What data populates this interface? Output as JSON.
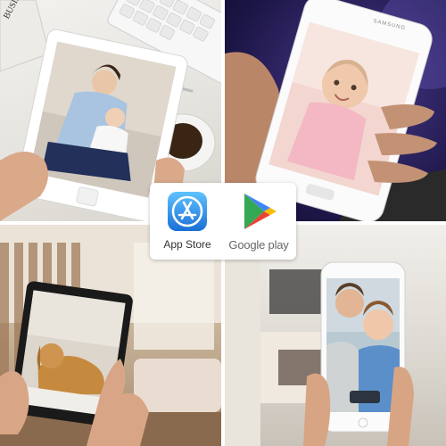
{
  "scenes": {
    "tablet_mother_baby": "tablet-mother-baby",
    "phone_baby": "phone-baby",
    "tablet_dog": "tablet-dog",
    "phone_father_son": "phone-father-son"
  },
  "printed_text": {
    "newspaper": "BUSINESS",
    "phone_brand": "SAMSUNG"
  },
  "stores": [
    {
      "label": "App Store",
      "icon": "app-store-icon"
    },
    {
      "label": "Google play",
      "icon": "google-play-icon"
    }
  ],
  "colors": {
    "app_store_blue": "#1e8de8",
    "google_green": "#34a853",
    "google_blue": "#4285f4",
    "google_red": "#ea4335",
    "google_yellow": "#fbbc05"
  }
}
